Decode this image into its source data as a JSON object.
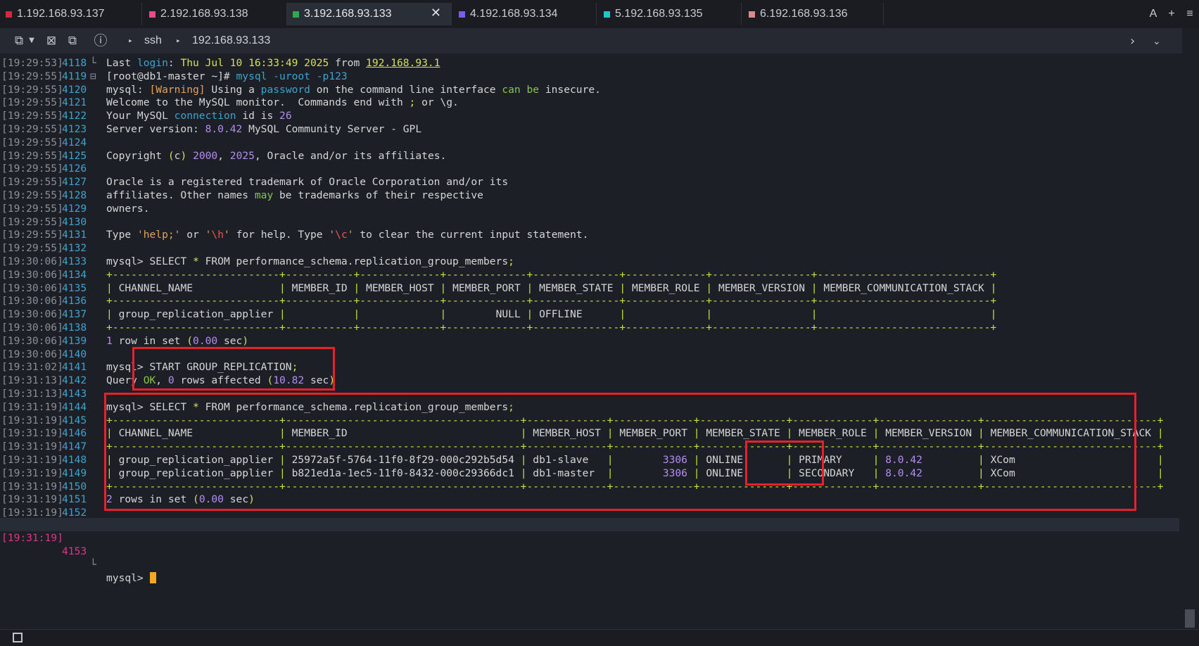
{
  "tabs": [
    {
      "label": "1.192.168.93.137",
      "color": "#d6283a",
      "active": false
    },
    {
      "label": "2.192.168.93.138",
      "color": "#e84a8c",
      "active": false
    },
    {
      "label": "3.192.168.93.133",
      "color": "#2fa84f",
      "active": true
    },
    {
      "label": "4.192.168.93.134",
      "color": "#7b5cf0",
      "active": false
    },
    {
      "label": "5.192.168.93.135",
      "color": "#1fc8c8",
      "active": false
    },
    {
      "label": "6.192.168.93.136",
      "color": "#d98a8a",
      "active": false
    }
  ],
  "tab_actions": {
    "font": "A",
    "add": "+",
    "menu": "≡"
  },
  "toolbar": {
    "protocol": "ssh",
    "host": "192.168.93.133"
  },
  "prompt_line": {
    "ts": "[19:31:19]",
    "ln": "4153",
    "text": "mysql> "
  },
  "lines": [
    {
      "ts": "[19:29:53]",
      "ln": "4118",
      "gut": "└",
      "html": "Last <span class=\"kw\">login</span>: <span class=\"lm\">Thu Jul 10 16:33:49 2025</span> from <span class=\"lm ul\">192.168.93.1</span>"
    },
    {
      "ts": "[19:29:55]",
      "ln": "4119",
      "gut": "⊟",
      "html": "[root@db1-master ~]# <span class=\"kw\">mysql</span> <span class=\"kw\">-uroot</span> <span class=\"kw\">-p123</span>"
    },
    {
      "ts": "[19:29:55]",
      "ln": "4120",
      "gut": "",
      "html": "mysql: <span class=\"str\">[Warning]</span> Using a <span class=\"kw\">password</span> on the command line interface <span class=\"grn\">can be</span> insecure."
    },
    {
      "ts": "[19:29:55]",
      "ln": "4121",
      "gut": "",
      "html": "Welcome to the MySQL monitor.  Commands end with <span class=\"lm\">;</span> or \\g."
    },
    {
      "ts": "[19:29:55]",
      "ln": "4122",
      "gut": "",
      "html": "Your MySQL <span class=\"kw\">connection</span> id is <span class=\"num\">26</span>"
    },
    {
      "ts": "[19:29:55]",
      "ln": "4123",
      "gut": "",
      "html": "Server version: <span class=\"num\">8.0.42</span> MySQL Community Server - GPL"
    },
    {
      "ts": "[19:29:55]",
      "ln": "4124",
      "gut": "",
      "html": ""
    },
    {
      "ts": "[19:29:55]",
      "ln": "4125",
      "gut": "",
      "html": "Copyright <span class=\"lm\">(</span>c<span class=\"lm\">)</span> <span class=\"num\">2000</span>, <span class=\"num\">2025</span>, Oracle and/or its affiliates."
    },
    {
      "ts": "[19:29:55]",
      "ln": "4126",
      "gut": "",
      "html": ""
    },
    {
      "ts": "[19:29:55]",
      "ln": "4127",
      "gut": "",
      "html": "Oracle is a registered trademark of Oracle Corporation and/or its"
    },
    {
      "ts": "[19:29:55]",
      "ln": "4128",
      "gut": "",
      "html": "affiliates. Other names <span class=\"grn\">may</span> be trademarks of their respective"
    },
    {
      "ts": "[19:29:55]",
      "ln": "4129",
      "gut": "",
      "html": "owners."
    },
    {
      "ts": "[19:29:55]",
      "ln": "4130",
      "gut": "",
      "html": ""
    },
    {
      "ts": "[19:29:55]",
      "ln": "4131",
      "gut": "",
      "html": "Type <span class=\"str\">'help;'</span> or <span class=\"str\">'<span class=\"red\">\\h</span>'</span> for help. Type <span class=\"str\">'<span class=\"red\">\\c</span>'</span> to clear the current input statement."
    },
    {
      "ts": "[19:29:55]",
      "ln": "4132",
      "gut": "",
      "html": ""
    },
    {
      "ts": "[19:30:06]",
      "ln": "4133",
      "gut": "",
      "html": "mysql&gt; SELECT <span class=\"lm\">*</span> FROM performance_schema.replication_group_members<span class=\"lm\">;</span>"
    },
    {
      "ts": "[19:30:06]",
      "ln": "4134",
      "gut": "",
      "html": "<span class=\"tbl\">+---------------------------+-----------+-------------+-------------+--------------+-------------+----------------+----------------------------+</span>"
    },
    {
      "ts": "[19:30:06]",
      "ln": "4135",
      "gut": "",
      "html": "<span class=\"tbl\">|</span> CHANNEL_NAME              <span class=\"tbl\">|</span> MEMBER_ID <span class=\"tbl\">|</span> MEMBER_HOST <span class=\"tbl\">|</span> MEMBER_PORT <span class=\"tbl\">|</span> MEMBER_STATE <span class=\"tbl\">|</span> MEMBER_ROLE <span class=\"tbl\">|</span> MEMBER_VERSION <span class=\"tbl\">|</span> MEMBER_COMMUNICATION_STACK <span class=\"tbl\">|</span>"
    },
    {
      "ts": "[19:30:06]",
      "ln": "4136",
      "gut": "",
      "html": "<span class=\"tbl\">+---------------------------+-----------+-------------+-------------+--------------+-------------+----------------+----------------------------+</span>"
    },
    {
      "ts": "[19:30:06]",
      "ln": "4137",
      "gut": "",
      "html": "<span class=\"tbl\">|</span> group_replication_applier <span class=\"tbl\">|</span>           <span class=\"tbl\">|</span>             <span class=\"tbl\">|</span>        NULL <span class=\"tbl\">|</span> OFFLINE      <span class=\"tbl\">|</span>             <span class=\"tbl\">|</span>                <span class=\"tbl\">|</span>                            <span class=\"tbl\">|</span>"
    },
    {
      "ts": "[19:30:06]",
      "ln": "4138",
      "gut": "",
      "html": "<span class=\"tbl\">+---------------------------+-----------+-------------+-------------+--------------+-------------+----------------+----------------------------+</span>"
    },
    {
      "ts": "[19:30:06]",
      "ln": "4139",
      "gut": "",
      "html": "<span class=\"num\">1</span> row in set <span class=\"lm\">(</span><span class=\"num\">0.00</span> sec<span class=\"lm\">)</span>"
    },
    {
      "ts": "[19:30:06]",
      "ln": "4140",
      "gut": "",
      "html": ""
    },
    {
      "ts": "[19:31:02]",
      "ln": "4141",
      "gut": "",
      "html": "mysql&gt; START GROUP_REPLICATION<span class=\"lm\">;</span>"
    },
    {
      "ts": "[19:31:13]",
      "ln": "4142",
      "gut": "",
      "html": "Query <span class=\"grn\">OK</span>, <span class=\"num\">0</span> rows affected <span class=\"lm\">(</span><span class=\"num\">10.82</span> sec<span class=\"lm\">)</span>"
    },
    {
      "ts": "[19:31:13]",
      "ln": "4143",
      "gut": "",
      "html": ""
    },
    {
      "ts": "[19:31:19]",
      "ln": "4144",
      "gut": "",
      "html": "mysql&gt; SELECT <span class=\"lm\">*</span> FROM performance_schema.replication_group_members<span class=\"lm\">;</span>"
    },
    {
      "ts": "[19:31:19]",
      "ln": "4145",
      "gut": "",
      "html": "<span class=\"tbl\">+---------------------------+--------------------------------------+-------------+-------------+--------------+-------------+----------------+----------------------------+</span>"
    },
    {
      "ts": "[19:31:19]",
      "ln": "4146",
      "gut": "",
      "html": "<span class=\"tbl\">|</span> CHANNEL_NAME              <span class=\"tbl\">|</span> MEMBER_ID                            <span class=\"tbl\">|</span> MEMBER_HOST <span class=\"tbl\">|</span> MEMBER_PORT <span class=\"tbl\">|</span> MEMBER_STATE <span class=\"tbl\">|</span> MEMBER_ROLE <span class=\"tbl\">|</span> MEMBER_VERSION <span class=\"tbl\">|</span> MEMBER_COMMUNICATION_STACK <span class=\"tbl\">|</span>"
    },
    {
      "ts": "[19:31:19]",
      "ln": "4147",
      "gut": "",
      "html": "<span class=\"tbl\">+---------------------------+--------------------------------------+-------------+-------------+--------------+-------------+----------------+----------------------------+</span>"
    },
    {
      "ts": "[19:31:19]",
      "ln": "4148",
      "gut": "",
      "html": "<span class=\"tbl\">|</span> group_replication_applier <span class=\"tbl\">|</span> 25972a5f-5764-11f0-8f29-000c292b5d54 <span class=\"tbl\">|</span> db1-slave   <span class=\"tbl\">|</span>        <span class=\"num\">3306</span> <span class=\"tbl\">|</span> ONLINE       <span class=\"tbl\">|</span> PRIMARY     <span class=\"tbl\">|</span> <span class=\"num\">8.0.42</span>         <span class=\"tbl\">|</span> XCom                       <span class=\"tbl\">|</span>"
    },
    {
      "ts": "[19:31:19]",
      "ln": "4149",
      "gut": "",
      "html": "<span class=\"tbl\">|</span> group_replication_applier <span class=\"tbl\">|</span> b821ed1a-1ec5-11f0-8432-000c29366dc1 <span class=\"tbl\">|</span> db1-master  <span class=\"tbl\">|</span>        <span class=\"num\">3306</span> <span class=\"tbl\">|</span> ONLINE       <span class=\"tbl\">|</span> SECONDARY   <span class=\"tbl\">|</span> <span class=\"num\">8.0.42</span>         <span class=\"tbl\">|</span> XCom                       <span class=\"tbl\">|</span>"
    },
    {
      "ts": "[19:31:19]",
      "ln": "4150",
      "gut": "",
      "html": "<span class=\"tbl\">+---------------------------+--------------------------------------+-------------+-------------+--------------+-------------+----------------+----------------------------+</span>"
    },
    {
      "ts": "[19:31:19]",
      "ln": "4151",
      "gut": "",
      "html": "<span class=\"num\">2</span> rows in set <span class=\"lm\">(</span><span class=\"num\">0.00</span> sec<span class=\"lm\">)</span>"
    },
    {
      "ts": "[19:31:19]",
      "ln": "4152",
      "gut": "",
      "html": ""
    }
  ]
}
